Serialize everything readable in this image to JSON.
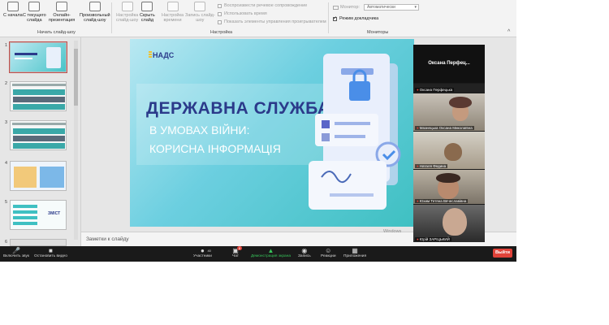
{
  "ribbon": {
    "from_start": "С начала",
    "from_current_l1": "С текущего",
    "from_current_l2": "слайда",
    "online_l1": "Онлайн-",
    "online_l2": "презентация",
    "custom_l1": "Произвольный",
    "custom_l2": "слайд-шоу",
    "group_start": "Начать слайд-шоу",
    "setup_l1": "Настройка",
    "setup_l2": "слайд-шоу",
    "hide_l1": "Скрыть",
    "hide_l2": "слайд",
    "timing_l1": "Настройка",
    "timing_l2": "времени",
    "record_l1": "Запись слайд-",
    "record_l2": "шоу",
    "chk_narration": "Воспроизвести речевое сопровождение",
    "chk_timings": "Использовать время",
    "chk_controls": "Показать элементы управления проигрывателем",
    "group_setup": "Настройка",
    "monitor_label": "Монитор:",
    "monitor_value": "Автоматически",
    "presenter_view": "Режим докладчика",
    "group_monitors": "Мониторы"
  },
  "thumbnails": [
    {
      "num": "1"
    },
    {
      "num": "2"
    },
    {
      "num": "3"
    },
    {
      "num": "4"
    },
    {
      "num": "5"
    },
    {
      "num": "6"
    }
  ],
  "thumb5_text": "ЗМІСТ",
  "slide": {
    "logo": "НАДС",
    "title_line1": "ДЕРЖАВНА СЛУЖБА",
    "title_line2": "В УМОВАХ ВІЙНИ:",
    "title_line3": "КОРИСНА ІНФОРМАЦІЯ"
  },
  "notes_placeholder": "Заметки к слайду",
  "windows_mark": "Windows",
  "video": {
    "active_speaker": "Оксана Перфец...",
    "participants": [
      "Оксана Перфецька",
      "Мазнецька Оксана Миколаївна",
      "Наталя Федина",
      "Юхим Тетяна Вячеславівна",
      "Юрій ЗАРІЦЬКИЙ"
    ]
  },
  "zoombar": {
    "unmute": "Включить звук",
    "stop_video": "Остановить видео",
    "participants": "Участники",
    "participants_count": "40",
    "chat": "Чат",
    "chat_badge": "8",
    "share": "Демонстрация экрана",
    "record": "Запись",
    "reactions": "Реакции",
    "apps": "Приложения",
    "leave": "Выйти"
  },
  "colors": {
    "slide_title": "#2b3a8a",
    "share_green": "#37c45a",
    "leave_red": "#e0433a"
  }
}
